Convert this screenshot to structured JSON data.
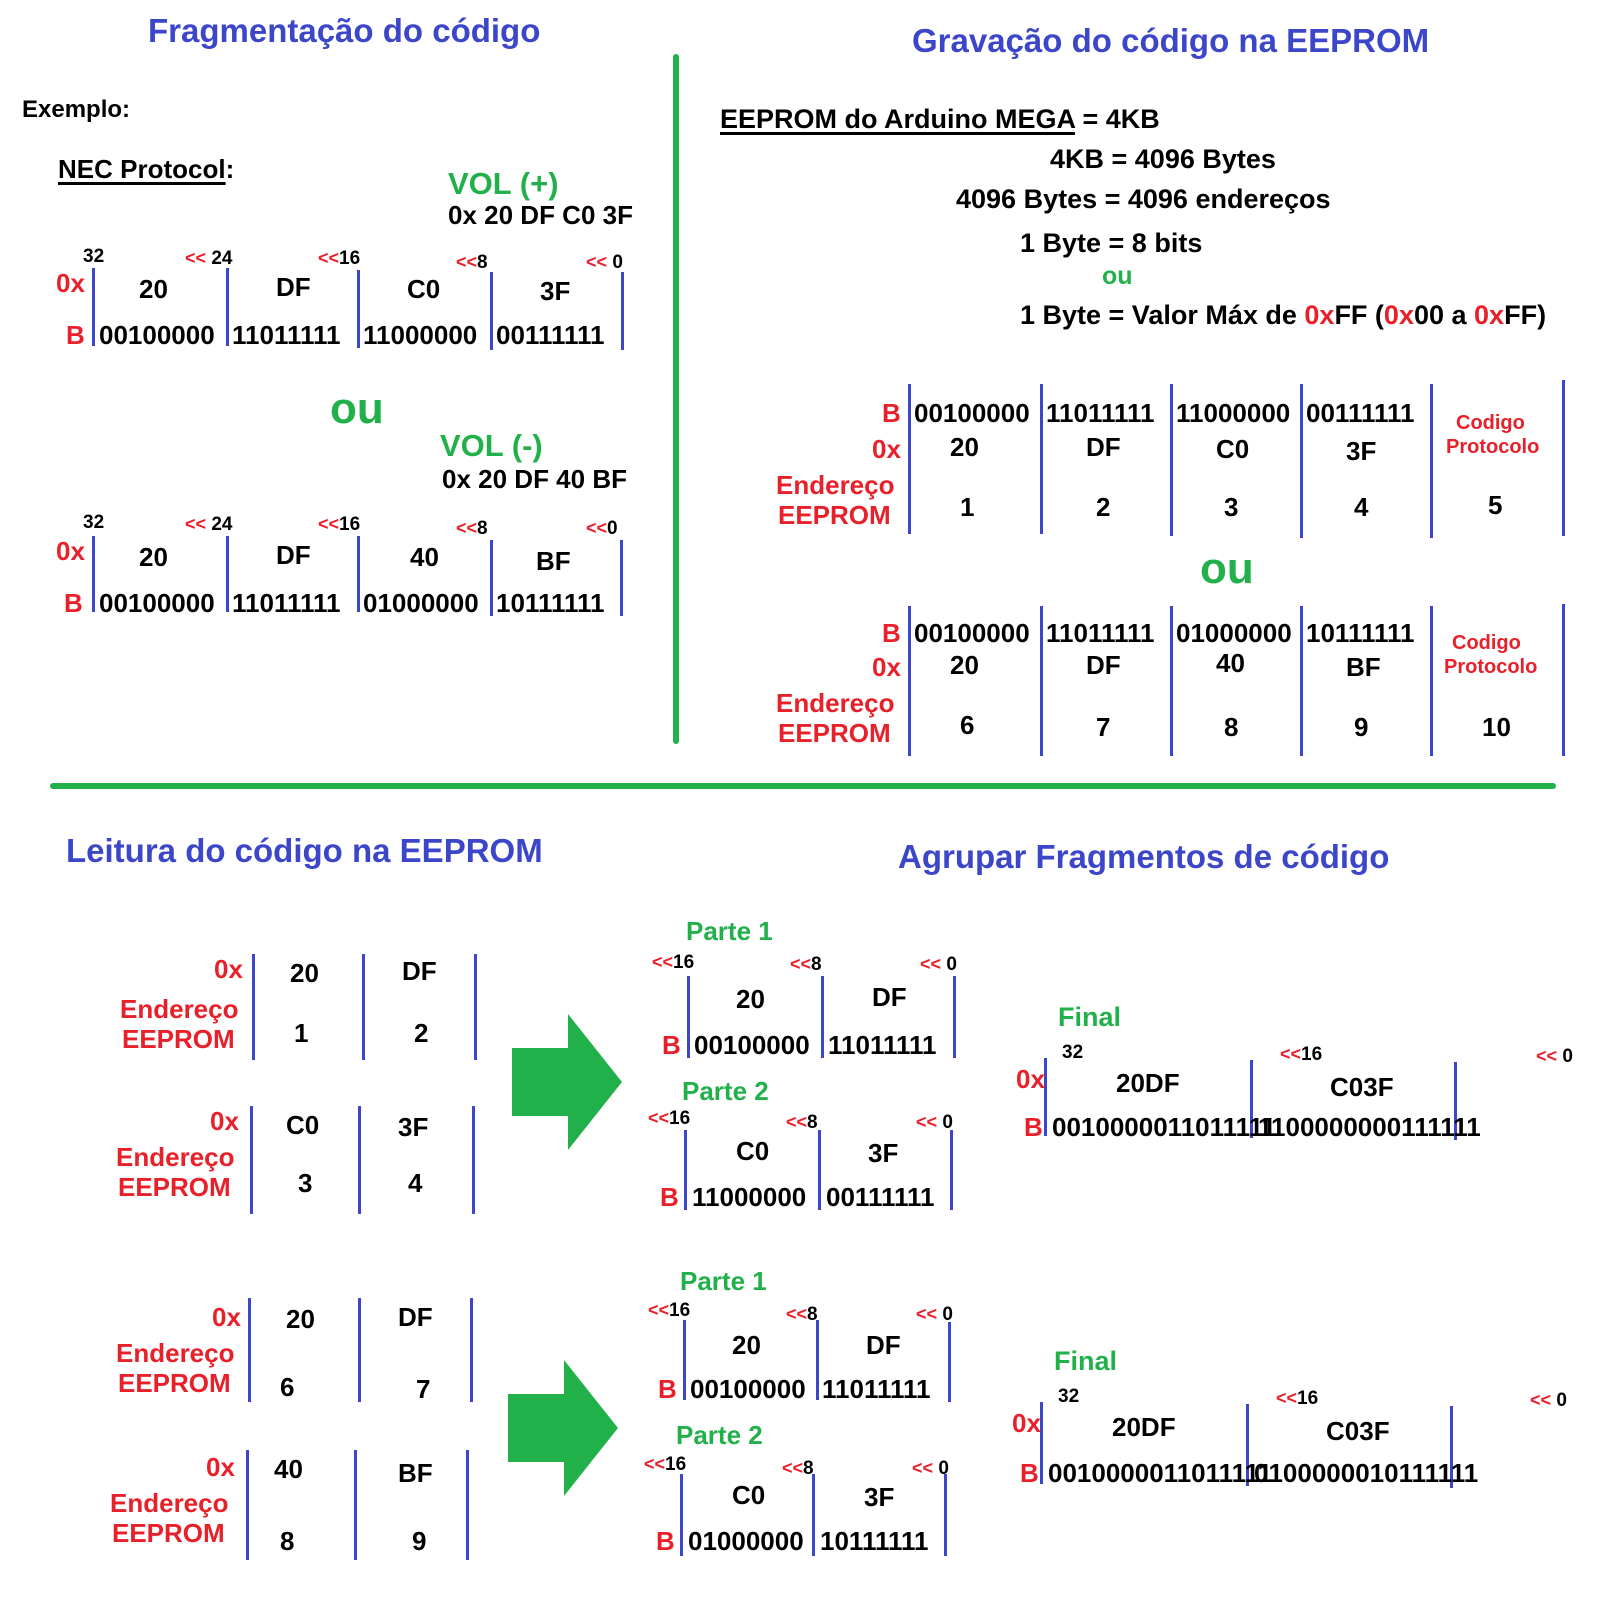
{
  "sections": {
    "fragmentation_title": "Fragmentação do código",
    "write_title": "Gravação do código na EEPROM",
    "read_title": "Leitura do código na EEPROM",
    "group_title": "Agrupar Fragmentos de código"
  },
  "colors": {
    "title": "#3c46c8",
    "accent_red": "#e8202a",
    "accent_green": "#22b04b",
    "divider": "#22b04b",
    "column_line": "#3c46c8"
  },
  "labels": {
    "hex_prefix": "0x",
    "bin_prefix": "B",
    "shift": "<<",
    "addr_line1": "Endereço",
    "addr_line2": "EEPROM",
    "or": "ou",
    "codigo1": "Codigo",
    "codigo2": "Protocolo",
    "bits32": "32"
  },
  "fragmentation": {
    "example": "Exemplo:",
    "protocol": "NEC Protocol",
    "colon": ":",
    "codes": [
      {
        "name": "VOL (+)",
        "full": "0x 20 DF C0 3F",
        "shifts": [
          "24",
          "16",
          "8",
          "0"
        ],
        "bytes": [
          {
            "hex": "20",
            "bin": "00100000"
          },
          {
            "hex": "DF",
            "bin": "11011111"
          },
          {
            "hex": "C0",
            "bin": "11000000"
          },
          {
            "hex": "3F",
            "bin": "00111111"
          }
        ]
      },
      {
        "name": "VOL (-)",
        "full": "0x 20 DF 40 BF",
        "shifts": [
          "24",
          "16",
          "8",
          "0"
        ],
        "bytes": [
          {
            "hex": "20",
            "bin": "00100000"
          },
          {
            "hex": "DF",
            "bin": "11011111"
          },
          {
            "hex": "40",
            "bin": "01000000"
          },
          {
            "hex": "BF",
            "bin": "10111111"
          }
        ]
      }
    ]
  },
  "eeprom": {
    "line1_a": "EEPROM do Arduino MEGA",
    "line1_b": " = 4KB",
    "line2": "4KB = 4096 Bytes",
    "line3": "4096 Bytes = 4096 endereços",
    "line4": "1 Byte = 8 bits",
    "line5_or": "ou",
    "line6": {
      "a": "1 Byte = Valor Máx de ",
      "b": "0x",
      "c": "FF (",
      "d": "0x",
      "e": "00 a ",
      "f": "0x",
      "g": "FF)"
    },
    "tables": [
      {
        "bin": [
          "00100000",
          "11011111",
          "11000000",
          "00111111"
        ],
        "hex": [
          "20",
          "DF",
          "C0",
          "3F"
        ],
        "addr": [
          "1",
          "2",
          "3",
          "4",
          "5"
        ]
      },
      {
        "bin": [
          "00100000",
          "11011111",
          "01000000",
          "10111111"
        ],
        "hex": [
          "20",
          "DF",
          "40",
          "BF"
        ],
        "addr": [
          "6",
          "7",
          "8",
          "9",
          "10"
        ]
      }
    ]
  },
  "reading": {
    "groups": [
      {
        "pairs": [
          {
            "hex": [
              "20",
              "DF"
            ],
            "addr": [
              "1",
              "2"
            ]
          },
          {
            "hex": [
              "C0",
              "3F"
            ],
            "addr": [
              "3",
              "4"
            ]
          }
        ],
        "parts": [
          {
            "label": "Parte 1",
            "hex": [
              "20",
              "DF"
            ],
            "bin": [
              "00100000",
              "11011111"
            ],
            "shifts": [
              "16",
              "8",
              "0"
            ]
          },
          {
            "label": "Parte 2",
            "hex": [
              "C0",
              "3F"
            ],
            "bin": [
              "11000000",
              "00111111"
            ],
            "shifts": [
              "16",
              "8",
              "0"
            ]
          }
        ],
        "final": {
          "label": "Final",
          "hex": [
            "20DF",
            "C03F"
          ],
          "bin": [
            "0010000011011111",
            "1100000000111111"
          ],
          "shifts": [
            "16",
            "0"
          ]
        }
      },
      {
        "pairs": [
          {
            "hex": [
              "20",
              "DF"
            ],
            "addr": [
              "6",
              "7"
            ]
          },
          {
            "hex": [
              "40",
              "BF"
            ],
            "addr": [
              "8",
              "9"
            ]
          }
        ],
        "parts": [
          {
            "label": "Parte 1",
            "hex": [
              "20",
              "DF"
            ],
            "bin": [
              "00100000",
              "11011111"
            ],
            "shifts": [
              "16",
              "8",
              "0"
            ]
          },
          {
            "label": "Parte 2",
            "hex": [
              "C0",
              "3F"
            ],
            "bin": [
              "01000000",
              "10111111"
            ],
            "shifts": [
              "16",
              "8",
              "0"
            ]
          }
        ],
        "final": {
          "label": "Final",
          "hex": [
            "20DF",
            "C03F"
          ],
          "bin": [
            "0010000011011111",
            "0100000010111111"
          ],
          "shifts": [
            "16",
            "0"
          ]
        }
      }
    ]
  }
}
